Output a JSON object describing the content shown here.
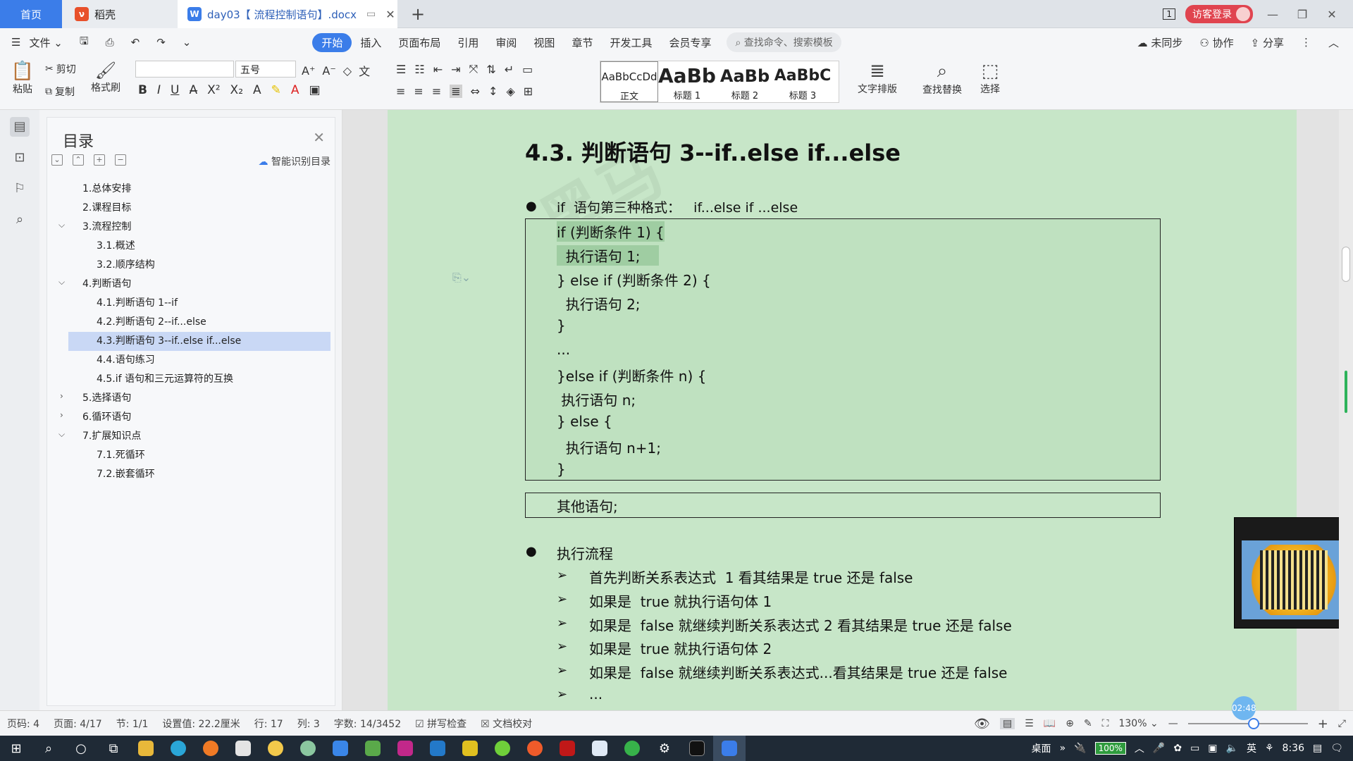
{
  "tabs": {
    "home": "首页",
    "daoke": "稻壳",
    "doc": "day03【 流程控制语句】.docx",
    "add": "+"
  },
  "titlebar": {
    "window_badge": "1",
    "login": "访客登录"
  },
  "menu": {
    "file": "文件",
    "items": [
      "开始",
      "插入",
      "页面布局",
      "引用",
      "审阅",
      "视图",
      "章节",
      "开发工具",
      "会员专享"
    ],
    "search": "查找命令、搜索模板",
    "sync": "未同步",
    "collab": "协作",
    "share": "分享"
  },
  "ribbon": {
    "paste": "粘贴",
    "cut": "剪切",
    "copy": "复制",
    "format_painter": "格式刷",
    "font_name": "",
    "font_size": "五号",
    "styles": [
      {
        "preview": "AaBbCcDd",
        "name": "正文"
      },
      {
        "preview": "AaBb",
        "name": "标题 1"
      },
      {
        "preview": "AaBb",
        "name": "标题 2"
      },
      {
        "preview": "AaBbC",
        "name": "标题 3"
      }
    ],
    "text_layout": "文字排版",
    "find_replace": "查找替换",
    "select": "选择"
  },
  "toc": {
    "title": "目录",
    "smart": "智能识别目录",
    "items": [
      "1.总体安排",
      "2.课程目标",
      "3.流程控制",
      "3.1.概述",
      "3.2.顺序结构",
      "4.判断语句",
      "4.1.判断语句 1--if",
      "4.2.判断语句 2--if...else",
      "4.3.判断语句 3--if..else if...else",
      "4.4.语句练习",
      "4.5.if 语句和三元运算符的互换",
      "5.选择语句",
      "6.循环语句",
      "7.扩展知识点",
      "7.1.死循环",
      "7.2.嵌套循环"
    ]
  },
  "doc": {
    "heading": "4.3. 判断语句 3--if..else if...else",
    "bullet1": "if  语句第三种格式：   if...else if ...else",
    "code": [
      "if (判断条件 1) {",
      "  执行语句 1;",
      "} else if (判断条件 2) {",
      "  执行语句 2;",
      "}",
      "...",
      "}else if (判断条件 n) {",
      " 执行语句 n;",
      "} else {",
      "  执行语句 n+1;",
      "}"
    ],
    "other": "其他语句;",
    "bullet2": "执行流程",
    "steps": [
      "首先判断关系表达式  1 看其结果是 true 还是 false",
      "如果是  true 就执行语句体 1",
      "如果是  false 就继续判断关系表达式 2 看其结果是 true 还是 false",
      "如果是  true 就执行语句体 2",
      "如果是  false 就继续判断关系表达式...看其结果是 true 还是 false",
      "..."
    ]
  },
  "statusbar": {
    "page_code": "页码: 4",
    "page": "页面: 4/17",
    "section": "节: 1/1",
    "setting": "设置值: 22.2厘米",
    "row": "行: 17",
    "col": "列: 3",
    "wordcount": "字数: 14/3452",
    "spell": "拼写检查",
    "proof": "文档校对",
    "zoom": "130%",
    "zoom_fraction": 0.55,
    "timer": "02:48"
  },
  "taskbar": {
    "desktop": "桌面",
    "battery": "100%",
    "ime": "英",
    "time": "8:36"
  }
}
